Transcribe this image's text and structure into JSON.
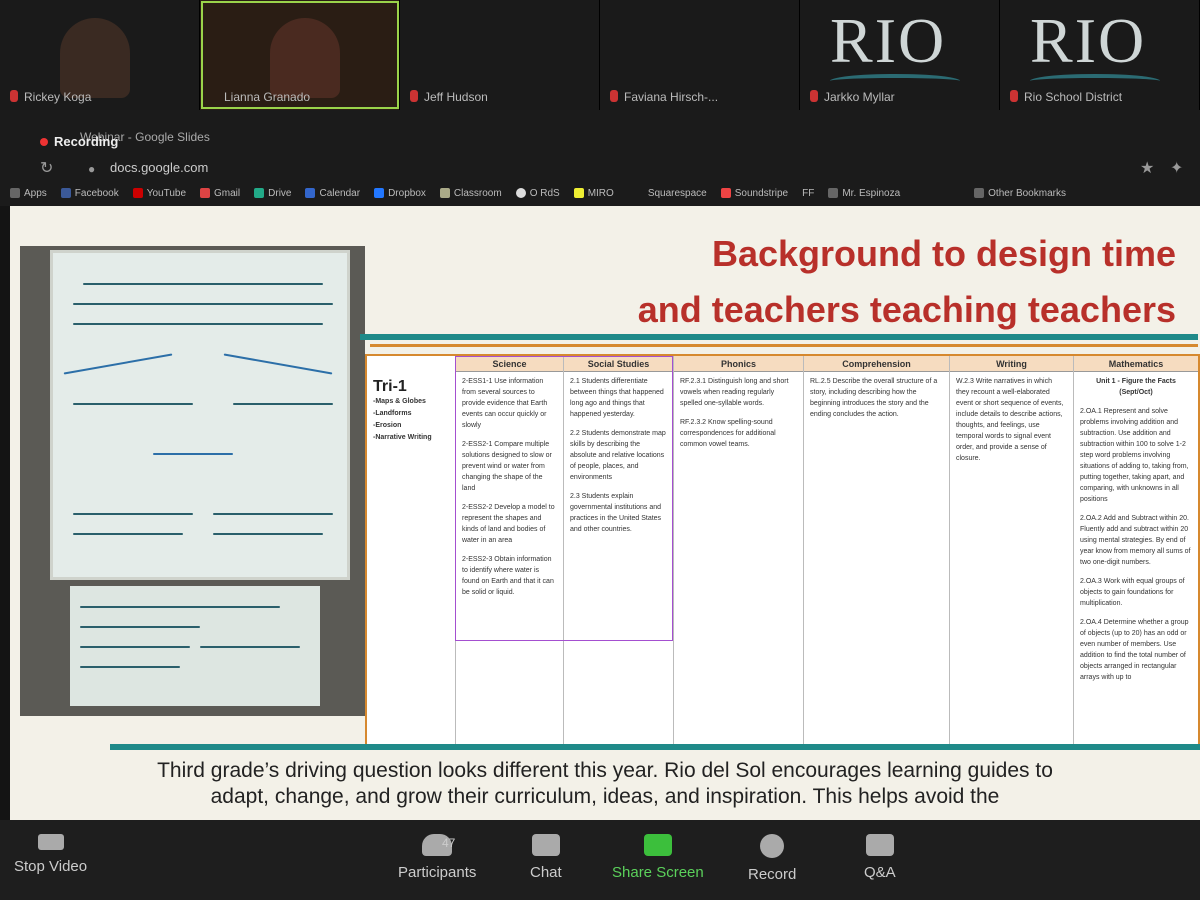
{
  "participants": [
    {
      "name": "Rickey Koga",
      "active": false
    },
    {
      "name": "Lianna Granado",
      "active": true
    },
    {
      "name": "Jeff Hudson",
      "active": false
    },
    {
      "name": "Faviana Hirsch-...",
      "active": false
    },
    {
      "name": "Jarkko Myllar",
      "active": false
    },
    {
      "name": "Rio School District",
      "active": false
    }
  ],
  "logos": [
    "RIO",
    "RIO"
  ],
  "browser": {
    "recording_label": "Recording",
    "tab_title": "Webinar - Google Slides",
    "url": "docs.google.com",
    "bookmarks": [
      "Apps",
      "Facebook",
      "YouTube",
      "Gmail",
      "Drive",
      "Calendar",
      "Dropbox",
      "Classroom",
      "O RdS",
      "MIRO",
      "Squarespace",
      "Soundstripe",
      "FF",
      "Mr. Espinoza",
      "Other Bookmarks"
    ]
  },
  "slide": {
    "title_line1": "Background to design time",
    "title_line2": "and teachers teaching teachers",
    "caption_line1": "Third grade’s driving question looks different this year. Rio del Sol encourages learning guides to",
    "caption_line2": "adapt, change, and grow their curriculum, ideas, and inspiration. This helps avoid the",
    "table": {
      "row_label": "Tri-1",
      "row_topics": [
        "-Maps & Globes",
        "-Landforms",
        "-Erosion",
        "-Narrative Writing"
      ],
      "columns": [
        {
          "header": "Science",
          "cells": [
            "2-ESS1-1 Use information from several sources to provide evidence that Earth events can occur quickly or slowly",
            "2-ESS2-1 Compare multiple solutions designed to slow or prevent wind or water from changing the shape of the land",
            "2-ESS2-2 Develop a model to represent the shapes and kinds of land and bodies of water in an area",
            "2-ESS2-3 Obtain information to identify where water is found on Earth and that it can be solid or liquid."
          ]
        },
        {
          "header": "Social Studies",
          "cells": [
            "2.1 Students differentiate between things that happened long ago and things that happened yesterday.",
            "2.2 Students demonstrate map skills by describing the absolute and relative locations of people, places, and environments",
            "2.3 Students explain governmental institutions and practices in the United States and other countries."
          ]
        },
        {
          "header": "Phonics",
          "cells": [
            "RF.2.3.1 Distinguish long and short vowels when reading regularly spelled one-syllable words.",
            "RF.2.3.2 Know spelling-sound correspondences for additional common vowel teams."
          ]
        },
        {
          "header": "Comprehension",
          "cells": [
            "RL.2.5 Describe the overall structure of a story, including describing how the beginning introduces the story and the ending concludes the action."
          ]
        },
        {
          "header": "Writing",
          "cells": [
            "W.2.3 Write narratives in which they recount a well-elaborated event or short sequence of events, include details to describe actions, thoughts, and feelings, use temporal words to signal event order, and provide a sense of closure."
          ]
        },
        {
          "header": "Mathematics",
          "cells": [
            "Unit 1 - Figure the Facts (Sept/Oct)",
            "2.OA.1 Represent and solve problems involving addition and subtraction. Use addition and subtraction within 100 to solve 1-2 step word problems involving situations of adding to, taking from, putting together, taking apart, and comparing, with unknowns in all positions",
            "2.OA.2 Add and Subtract within 20. Fluently add and subtract within 20 using mental strategies. By end of year know from memory all sums of two one-digit numbers.",
            "2.OA.3 Work with equal groups of objects to gain foundations for multiplication.",
            "2.OA.4 Determine whether a group of objects (up to 20) has an odd or even number of members. Use addition to find the total number of objects arranged in rectangular arrays with up to"
          ]
        }
      ]
    }
  },
  "toolbar": {
    "stop_video": "Stop Video",
    "participants": "Participants",
    "participants_count": "47",
    "chat": "Chat",
    "share_screen": "Share Screen",
    "record": "Record",
    "qa": "Q&A"
  }
}
